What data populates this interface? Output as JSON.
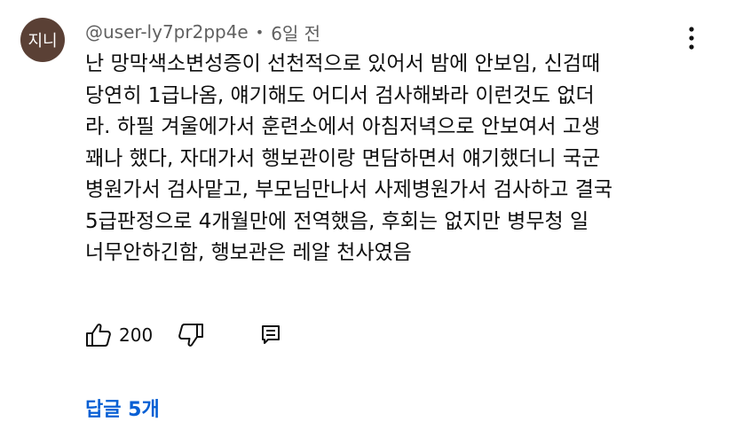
{
  "author": {
    "avatar_text": "지니",
    "handle": "@user-ly7pr2pp4e",
    "separator": "•",
    "time": "6일 전"
  },
  "comment": {
    "text": "난 망막색소변성증이 선천적으로 있어서 밤에 안보임, 신검때\n당연히 1급나옴, 얘기해도 어디서 검사해봐라 이런것도 없더\n라. 하필 겨울에가서 훈련소에서 아침저녁으로 안보여서 고생\n꽤나 했다, 자대가서 행보관이랑 면담하면서 얘기했더니 국군\n병원가서 검사맡고, 부모님만나서 사제병원가서 검사하고 결국\n5급판정으로 4개월만에 전역했음, 후회는 없지만 병무청 일\n너무안하긴함, 행보관은 레알 천사였음"
  },
  "actions": {
    "like_count": "200",
    "like_icon": "thumbs-up-icon",
    "dislike_icon": "thumbs-down-icon",
    "reply_icon": "comment-icon"
  },
  "menu_icon": "more-vertical-icon",
  "replies": {
    "label": "답글 5개"
  },
  "colors": {
    "avatar_bg": "#5a4035",
    "meta_text": "#606060",
    "link_blue": "#065fd4"
  }
}
